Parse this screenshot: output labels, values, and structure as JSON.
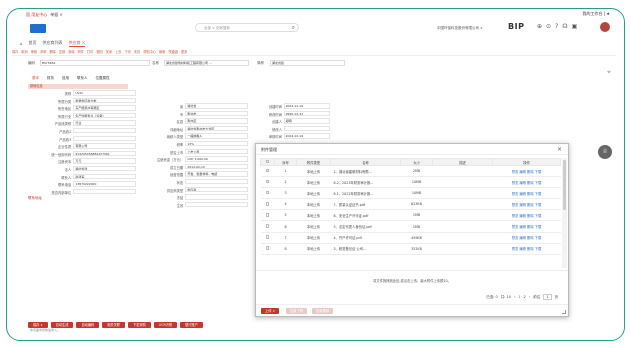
{
  "tabs": {
    "items": [
      "国 用友中心",
      "单据 ×"
    ],
    "right": "我的工作台 | ★"
  },
  "header": {
    "search_placeholder": "全部 ∨  全局搜索",
    "org": "中国环保科技股份有限公司 ∨",
    "bip": "BIP"
  },
  "nav": {
    "home": "首页",
    "list": "供应商列表",
    "active": "供应商 ×"
  },
  "toolbar": {
    "items": [
      "保存",
      "取消",
      "审核",
      "弃审",
      "删除",
      "复制",
      "新增",
      "附件",
      "打印",
      "退回",
      "关闭",
      "上页",
      "下页",
      "末页",
      "帮助中心",
      "刷新",
      "快捷键",
      "更多"
    ]
  },
  "form_top": {
    "code_label": "编码",
    "code_value": "BSY5469",
    "name_label": "名称",
    "name_value": "湖北省建筑材料和工程有限公司 ...",
    "short_label": "简称",
    "short_value": "湖北省建"
  },
  "subtabs": [
    "基本",
    "财务",
    "信用",
    "联系人",
    "位置属性"
  ],
  "section_label": "基础信息",
  "col1": [
    {
      "l": "类别",
      "v": "Uvdz"
    },
    {
      "l": "所属分类",
      "v": "批量供应商分类"
    },
    {
      "l": "所在地区",
      "v": "东产能源州有限区"
    },
    {
      "l": "所属行业",
      "v": "生产性服务业（设备）"
    },
    {
      "l": "产品线类别",
      "v": "行业"
    },
    {
      "l": "产品线2",
      "v": ""
    },
    {
      "l": "产品线3",
      "v": ""
    },
    {
      "l": "企业性质",
      "v": "有限公司"
    },
    {
      "l": "统一信用代码",
      "v": "91420545688232799L"
    },
    {
      "l": "注册资本",
      "v": "万元"
    },
    {
      "l": "法人",
      "v": "湖北省建"
    },
    {
      "l": "联系人",
      "v": "赵建军"
    },
    {
      "l": "联系电话",
      "v": "13870222000"
    },
    {
      "l": "是否内部单位",
      "v": ""
    }
  ],
  "col1_extra": "联系地址",
  "col2": [
    {
      "l": "省",
      "v": "湖北省"
    },
    {
      "l": "市",
      "v": "荆州市"
    },
    {
      "l": "区县",
      "v": "荆州区"
    },
    {
      "l": "详细地址",
      "v": "湖北省荆州市大龙区"
    },
    {
      "l": "纳税人类型",
      "v": "一般纳税人"
    },
    {
      "l": "税率",
      "v": "13%"
    },
    {
      "l": "是否上市",
      "v": "上市公司"
    },
    {
      "l": "注册资金（万元）",
      "v": "CNY 1,000.00"
    },
    {
      "l": "成立日期",
      "v": "2012-02-10"
    },
    {
      "l": "经营范围",
      "v": "开发、批量材料、电缆"
    },
    {
      "l": "状态",
      "v": ""
    },
    {
      "l": "供应商类型",
      "v": "供应商"
    },
    {
      "l": "冻结",
      "v": ""
    },
    {
      "l": "生效",
      "v": ""
    }
  ],
  "col3": [
    {
      "l": "创建时间",
      "v": "2024-12-19"
    },
    {
      "l": "修改时间",
      "v": "9990-12-31"
    },
    {
      "l": "创建人",
      "v": "郑明"
    },
    {
      "l": "修改人",
      "v": ""
    },
    {
      "l": "审核时间",
      "v": "2024-12-19"
    }
  ],
  "footer_buttons": [
    "保存 ∨",
    "自动生成",
    "自动编码",
    "相关关联",
    "下发采购",
    "OCR识别",
    "银行账户"
  ],
  "footnote": "本页面支持快速录入。",
  "modal": {
    "title": "附件管理",
    "columns": [
      "",
      "序号",
      "附件类型",
      "名称",
      "大小",
      "描述",
      "操作"
    ],
    "rows": [
      {
        "n": "1",
        "type": "本地上传",
        "name": "1、湖北省建筑材料有限...",
        "size": "2MB",
        "ops": "预览 编辑 删除 下载"
      },
      {
        "n": "2",
        "type": "本地上传",
        "name": "8.2、2023年财务审计报...",
        "size": "10MB",
        "ops": "预览 编辑 删除 下载"
      },
      {
        "n": "3",
        "type": "本地上传",
        "name": "8.1、2022年财务审计报...",
        "size": "10MB",
        "ops": "预览 编辑 删除 下载"
      },
      {
        "n": "4",
        "type": "本地上传",
        "name": "7、质量认证证书.pdf",
        "size": "623KB",
        "ops": "预览 编辑 删除 下载"
      },
      {
        "n": "5",
        "type": "本地上传",
        "name": "6、安全生产许可证.pdf",
        "size": "1MB",
        "ops": "预览 编辑 删除 下载"
      },
      {
        "n": "6",
        "type": "本地上传",
        "name": "5、法定代表人身份证.pdf",
        "size": "1MB",
        "ops": "预览 编辑 删除 下载"
      },
      {
        "n": "7",
        "type": "本地上传",
        "name": "4、开户许可证.pdf",
        "size": "499KB",
        "ops": "预览 编辑 删除 下载"
      },
      {
        "n": "8",
        "type": "本地上传",
        "name": "3、税务登记证 公司...",
        "size": "352KB",
        "ops": "预览 编辑 删除 下载"
      }
    ],
    "hint": "将文件拖拽到此处,或点击上传。最大附件上传额10。",
    "pager": {
      "total": "已选: 0",
      "per": "共: 10",
      "prev": "‹",
      "cur": "1",
      "next": "2",
      "nxt": "›",
      "jump": "前往",
      "page": "1",
      "unit": "页"
    },
    "upload": "上传 ∨",
    "batch_download": "批量下载",
    "batch_delete": "批量删除"
  }
}
